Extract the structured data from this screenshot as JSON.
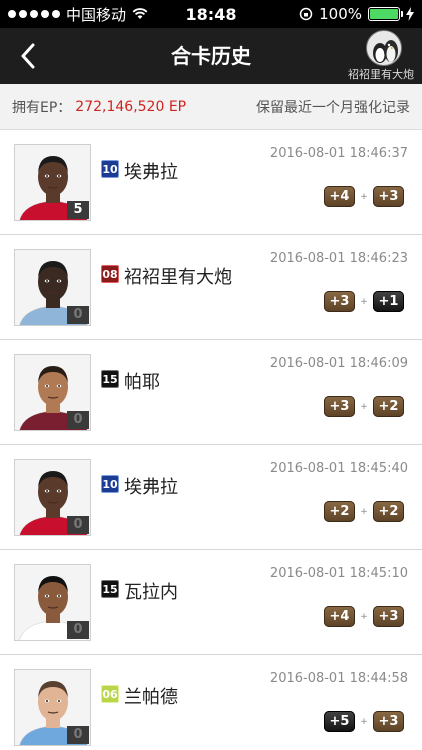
{
  "status_bar": {
    "carrier": "中国移动",
    "time": "18:48",
    "battery_text": "100%"
  },
  "nav": {
    "title": "合卡历史",
    "username": "袑袑里有大炮"
  },
  "info": {
    "ep_label": "拥有EP：",
    "ep_value": "272,146,520 EP",
    "note": "保留最近一个月强化记录"
  },
  "records": [
    {
      "number": "10",
      "badge_color": "navy",
      "name": "埃弗拉",
      "level": "5",
      "time": "2016-08-01 18:46:37",
      "chip1": "+4",
      "chip2": "+3",
      "chip2_style": "brown",
      "skin": "#5a3a2a",
      "shirt": "#c8102e",
      "hair": "#1a1a1a"
    },
    {
      "number": "08",
      "badge_color": "red",
      "name": "袑袑里有大炮",
      "level": "0",
      "time": "2016-08-01 18:46:23",
      "chip1": "+3",
      "chip2": "+1",
      "chip2_style": "dark",
      "skin": "#3a2a22",
      "shirt": "#8fb6d8",
      "hair": "#1a1a1a"
    },
    {
      "number": "15",
      "badge_color": "black",
      "name": "帕耶",
      "level": "0",
      "time": "2016-08-01 18:46:09",
      "chip1": "+3",
      "chip2": "+2",
      "chip2_style": "brown",
      "skin": "#b07a55",
      "shirt": "#7a1f2f",
      "hair": "#2a1d15"
    },
    {
      "number": "10",
      "badge_color": "navy",
      "name": "埃弗拉",
      "level": "0",
      "time": "2016-08-01 18:45:40",
      "chip1": "+2",
      "chip2": "+2",
      "chip2_style": "brown",
      "skin": "#5a3a2a",
      "shirt": "#c8102e",
      "hair": "#1a1a1a"
    },
    {
      "number": "15",
      "badge_color": "black",
      "name": "瓦拉内",
      "level": "0",
      "time": "2016-08-01 18:45:10",
      "chip1": "+4",
      "chip2": "+3",
      "chip2_style": "brown",
      "skin": "#8a5a3c",
      "shirt": "#ffffff",
      "hair": "#111111"
    },
    {
      "number": "06",
      "badge_color": "lime",
      "name": "兰帕德",
      "level": "0",
      "time": "2016-08-01 18:44:58",
      "chip1": "+5",
      "chip2": "+3",
      "chip2_style": "brown",
      "chip1_style": "dark",
      "skin": "#e0b494",
      "shirt": "#6fa8dc",
      "hair": "#5a4030"
    }
  ]
}
